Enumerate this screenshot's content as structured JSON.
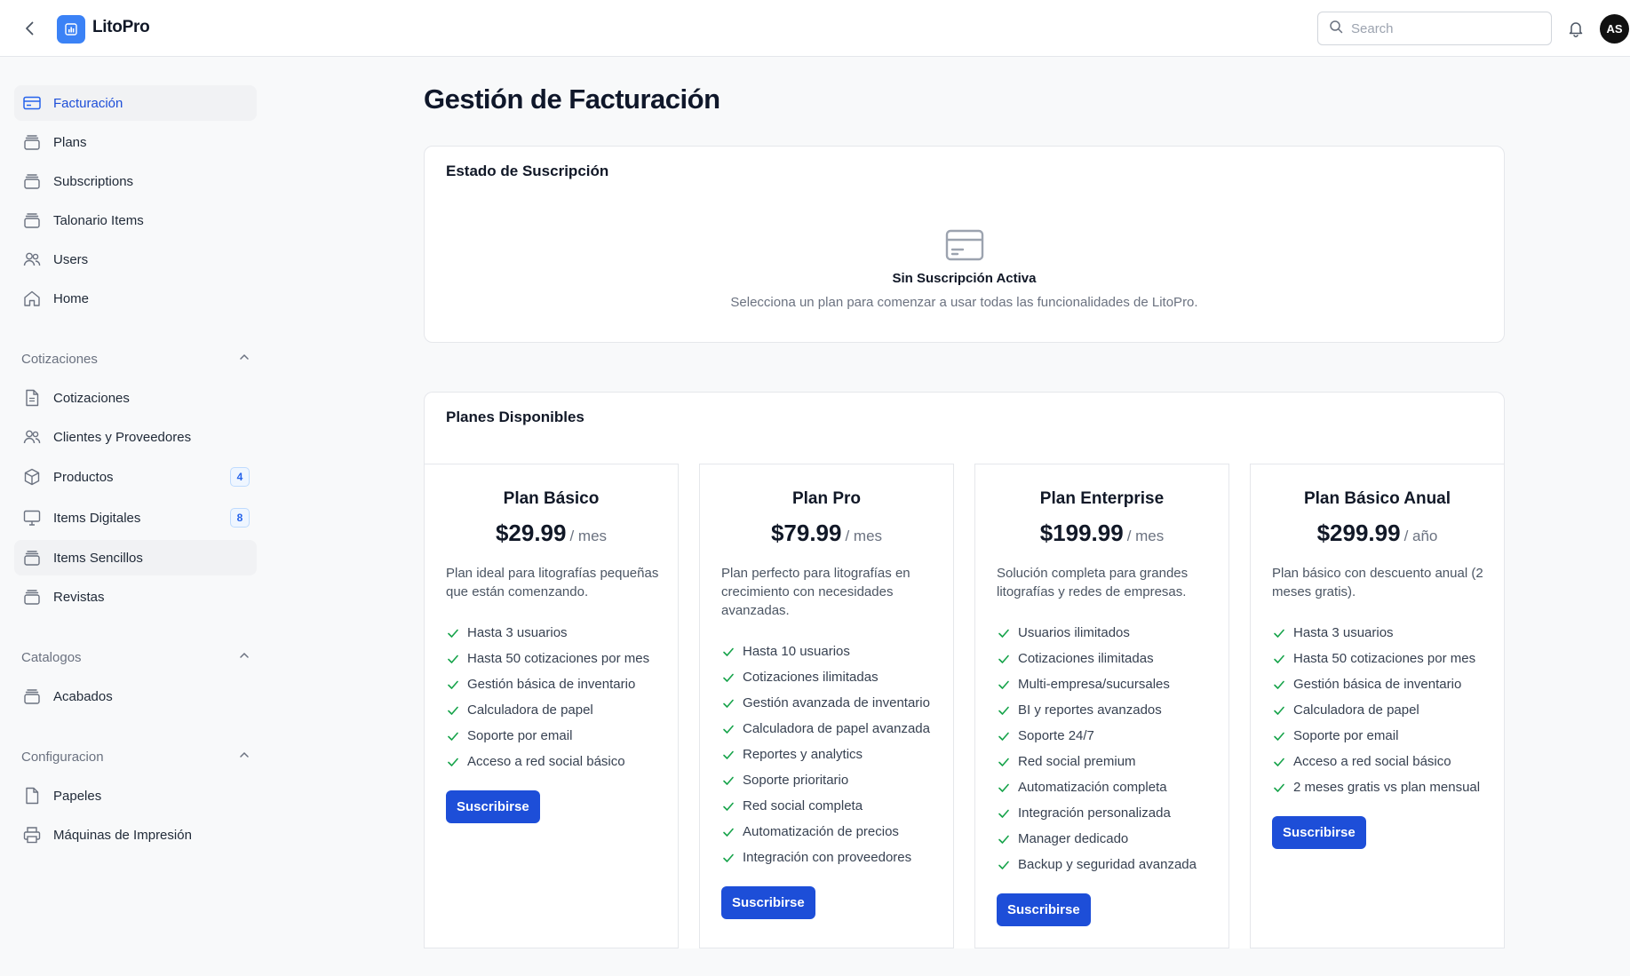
{
  "app": {
    "name": "LitoPro",
    "search_placeholder": "Search",
    "avatar_initials": "AS"
  },
  "sidebar": {
    "main_items": [
      {
        "label": "Facturación",
        "icon": "credit-card-icon"
      },
      {
        "label": "Plans",
        "icon": "stack-icon"
      },
      {
        "label": "Subscriptions",
        "icon": "stack-icon"
      },
      {
        "label": "Talonario Items",
        "icon": "stack-icon"
      },
      {
        "label": "Users",
        "icon": "users-icon"
      },
      {
        "label": "Home",
        "icon": "home-icon"
      }
    ],
    "cotizaciones": {
      "label": "Cotizaciones",
      "items": [
        {
          "label": "Cotizaciones",
          "icon": "document-icon"
        },
        {
          "label": "Clientes y Proveedores",
          "icon": "users-icon"
        },
        {
          "label": "Productos",
          "icon": "cube-icon",
          "badge": "4"
        },
        {
          "label": "Items Digitales",
          "icon": "monitor-icon",
          "badge": "8"
        },
        {
          "label": "Items Sencillos",
          "icon": "stack-icon"
        },
        {
          "label": "Revistas",
          "icon": "stack-icon"
        }
      ]
    },
    "catalogos": {
      "label": "Catalogos",
      "items": [
        {
          "label": "Acabados",
          "icon": "stack-icon"
        }
      ]
    },
    "configuracion": {
      "label": "Configuracion",
      "items": [
        {
          "label": "Papeles",
          "icon": "document-icon"
        },
        {
          "label": "Máquinas de Impresión",
          "icon": "printer-icon"
        }
      ]
    }
  },
  "main": {
    "title": "Gestión de Facturación",
    "subscription": {
      "title": "Estado de Suscripción",
      "empty_title": "Sin Suscripción Activa",
      "empty_text": "Selecciona un plan para comenzar a usar todas las funcionalidades de LitoPro."
    },
    "plans_section": {
      "title": "Planes Disponibles",
      "plans": [
        {
          "name": "Plan Básico",
          "price": "$29.99",
          "period": "/ mes",
          "description": "Plan ideal para litografías pequeñas que están comenzando.",
          "features": [
            "Hasta 3 usuarios",
            "Hasta 50 cotizaciones por mes",
            "Gestión básica de inventario",
            "Calculadora de papel",
            "Soporte por email",
            "Acceso a red social básico"
          ],
          "button": "Suscribirse"
        },
        {
          "name": "Plan Pro",
          "price": "$79.99",
          "period": "/ mes",
          "description": "Plan perfecto para litografías en crecimiento con necesidades avanzadas.",
          "features": [
            "Hasta 10 usuarios",
            "Cotizaciones ilimitadas",
            "Gestión avanzada de inventario",
            "Calculadora de papel avanzada",
            "Reportes y analytics",
            "Soporte prioritario",
            "Red social completa",
            "Automatización de precios",
            "Integración con proveedores"
          ],
          "button": "Suscribirse"
        },
        {
          "name": "Plan Enterprise",
          "price": "$199.99",
          "period": "/ mes",
          "description": "Solución completa para grandes litografías y redes de empresas.",
          "features": [
            "Usuarios ilimitados",
            "Cotizaciones ilimitadas",
            "Multi-empresa/sucursales",
            "BI y reportes avanzados",
            "Soporte 24/7",
            "Red social premium",
            "Automatización completa",
            "Integración personalizada",
            "Manager dedicado",
            "Backup y seguridad avanzada"
          ],
          "button": "Suscribirse"
        },
        {
          "name": "Plan Básico Anual",
          "price": "$299.99",
          "period": "/ año",
          "description": "Plan básico con descuento anual (2 meses gratis).",
          "features": [
            "Hasta 3 usuarios",
            "Hasta 50 cotizaciones por mes",
            "Gestión básica de inventario",
            "Calculadora de papel",
            "Soporte por email",
            "Acceso a red social básico",
            "2 meses gratis vs plan mensual"
          ],
          "button": "Suscribirse"
        }
      ]
    }
  },
  "colors": {
    "primary": "#1d4ed8",
    "logo": "#3b82f6",
    "check": "#16a34a",
    "badge_text": "#2563eb"
  }
}
